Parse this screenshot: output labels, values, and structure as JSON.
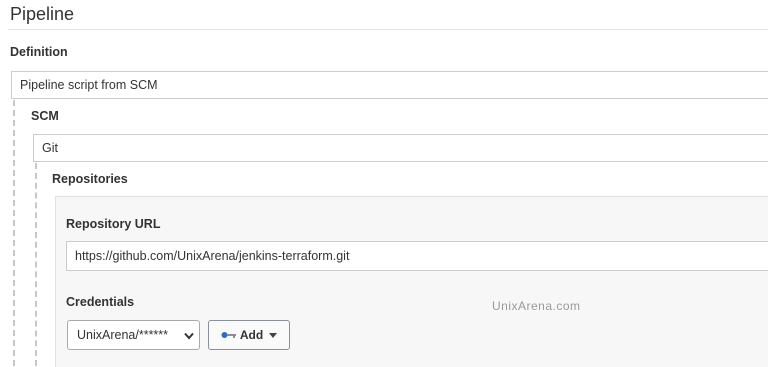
{
  "pipeline": {
    "title": "Pipeline",
    "definition_label": "Definition",
    "definition_value": "Pipeline script from SCM"
  },
  "scm": {
    "label": "SCM",
    "value": "Git",
    "repositories_label": "Repositories",
    "repository_url_label": "Repository URL",
    "repository_url_value": "https://github.com/UnixArena/jenkins-terraform.git",
    "credentials_label": "Credentials",
    "credentials_value": "UnixArena/******",
    "add_button_label": "Add"
  },
  "watermark": "UnixArena.com",
  "icons": {
    "add_button_icon": "key-icon",
    "add_button_caret": "caret-down-icon",
    "credentials_caret": "chevron-down-icon"
  },
  "colors": {
    "panel_background": "#f7f7f7",
    "border": "#cccccc",
    "dashed_guide": "#c8c8c8"
  }
}
